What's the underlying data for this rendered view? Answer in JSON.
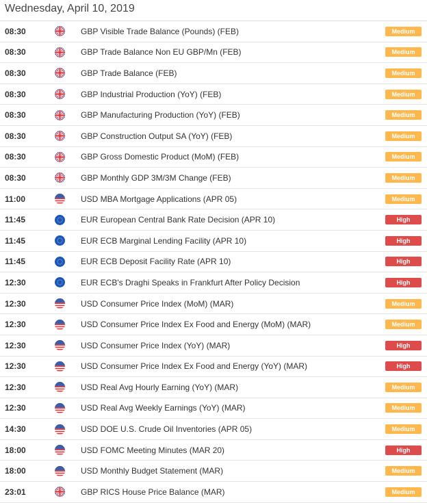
{
  "header": {
    "date": "Wednesday, April 10, 2019"
  },
  "colors": {
    "medium": "#ffb84d",
    "high": "#dd4b4b"
  },
  "events": [
    {
      "time": "08:30",
      "flag": "gb-flag-icon",
      "title": "GBP Visible Trade Balance (Pounds) (FEB)",
      "impact": "Medium"
    },
    {
      "time": "08:30",
      "flag": "gb-flag-icon",
      "title": "GBP Trade Balance Non EU GBP/Mn (FEB)",
      "impact": "Medium"
    },
    {
      "time": "08:30",
      "flag": "gb-flag-icon",
      "title": "GBP Trade Balance (FEB)",
      "impact": "Medium"
    },
    {
      "time": "08:30",
      "flag": "gb-flag-icon",
      "title": "GBP Industrial Production (YoY) (FEB)",
      "impact": "Medium"
    },
    {
      "time": "08:30",
      "flag": "gb-flag-icon",
      "title": "GBP Manufacturing Production (YoY) (FEB)",
      "impact": "Medium"
    },
    {
      "time": "08:30",
      "flag": "gb-flag-icon",
      "title": "GBP Construction Output SA (YoY) (FEB)",
      "impact": "Medium"
    },
    {
      "time": "08:30",
      "flag": "gb-flag-icon",
      "title": "GBP Gross Domestic Product (MoM) (FEB)",
      "impact": "Medium"
    },
    {
      "time": "08:30",
      "flag": "gb-flag-icon",
      "title": "GBP Monthly GDP 3M/3M Change (FEB)",
      "impact": "Medium"
    },
    {
      "time": "11:00",
      "flag": "us-flag-icon",
      "title": "USD MBA Mortgage Applications (APR 05)",
      "impact": "Medium"
    },
    {
      "time": "11:45",
      "flag": "eu-flag-icon",
      "title": "EUR European Central Bank Rate Decision (APR 10)",
      "impact": "High"
    },
    {
      "time": "11:45",
      "flag": "eu-flag-icon",
      "title": "EUR ECB Marginal Lending Facility (APR 10)",
      "impact": "High"
    },
    {
      "time": "11:45",
      "flag": "eu-flag-icon",
      "title": "EUR ECB Deposit Facility Rate (APR 10)",
      "impact": "High"
    },
    {
      "time": "12:30",
      "flag": "eu-flag-icon",
      "title": "EUR ECB's Draghi Speaks in Frankfurt After Policy Decision",
      "impact": "High"
    },
    {
      "time": "12:30",
      "flag": "us-flag-icon",
      "title": "USD Consumer Price Index (MoM) (MAR)",
      "impact": "Medium"
    },
    {
      "time": "12:30",
      "flag": "us-flag-icon",
      "title": "USD Consumer Price Index Ex Food and Energy (MoM) (MAR)",
      "impact": "Medium"
    },
    {
      "time": "12:30",
      "flag": "us-flag-icon",
      "title": "USD Consumer Price Index (YoY) (MAR)",
      "impact": "High"
    },
    {
      "time": "12:30",
      "flag": "us-flag-icon",
      "title": "USD Consumer Price Index Ex Food and Energy (YoY) (MAR)",
      "impact": "High"
    },
    {
      "time": "12:30",
      "flag": "us-flag-icon",
      "title": "USD Real Avg Hourly Earning (YoY) (MAR)",
      "impact": "Medium"
    },
    {
      "time": "12:30",
      "flag": "us-flag-icon",
      "title": "USD Real Avg Weekly Earnings (YoY) (MAR)",
      "impact": "Medium"
    },
    {
      "time": "14:30",
      "flag": "us-flag-icon",
      "title": "USD DOE U.S. Crude Oil Inventories (APR 05)",
      "impact": "Medium"
    },
    {
      "time": "18:00",
      "flag": "us-flag-icon",
      "title": "USD FOMC Meeting Minutes (MAR 20)",
      "impact": "High"
    },
    {
      "time": "18:00",
      "flag": "us-flag-icon",
      "title": "USD Monthly Budget Statement (MAR)",
      "impact": "Medium"
    },
    {
      "time": "23:01",
      "flag": "gb-flag-icon",
      "title": "GBP RICS House Price Balance (MAR)",
      "impact": "Medium"
    }
  ]
}
